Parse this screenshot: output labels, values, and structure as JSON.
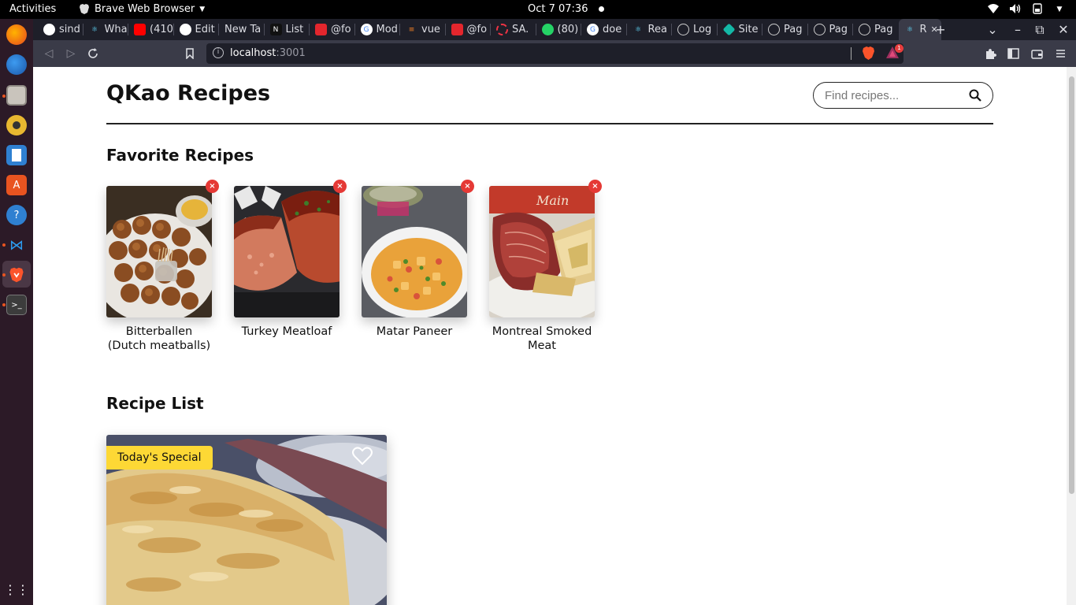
{
  "system": {
    "activities": "Activities",
    "app_name": "Brave Web Browser",
    "clock": "Oct 7  07:36"
  },
  "browser": {
    "tabs": [
      {
        "label": "sind",
        "icon": "github-icon"
      },
      {
        "label": "Wha",
        "icon": "react-icon"
      },
      {
        "label": "(410",
        "icon": "youtube-icon"
      },
      {
        "label": "Edit",
        "icon": "github-icon"
      },
      {
        "label": "New Ta",
        "icon": "none"
      },
      {
        "label": "List",
        "icon": "notion-icon"
      },
      {
        "label": "@fo",
        "icon": "frappe-icon"
      },
      {
        "label": "Mod",
        "icon": "google-icon"
      },
      {
        "label": "vue",
        "icon": "stackoverflow-icon"
      },
      {
        "label": "@fo",
        "icon": "frappe-icon"
      },
      {
        "label": "SA.",
        "icon": "loading-icon"
      },
      {
        "label": "(80)",
        "icon": "whatsapp-icon"
      },
      {
        "label": "doe",
        "icon": "google-icon"
      },
      {
        "label": "Rea",
        "icon": "react-icon"
      },
      {
        "label": "Log",
        "icon": "globe-icon"
      },
      {
        "label": "Site",
        "icon": "diamond-icon"
      },
      {
        "label": "Pag",
        "icon": "globe-icon"
      },
      {
        "label": "Pag",
        "icon": "globe-icon"
      },
      {
        "label": "Pag",
        "icon": "globe-icon"
      },
      {
        "label": "R",
        "icon": "react-icon",
        "active": true
      }
    ],
    "url_host": "localhost",
    "url_port": ":3001",
    "rewards_badge": "1"
  },
  "page": {
    "title": "QKao Recipes",
    "search_placeholder": "Find recipes...",
    "favorites_heading": "Favorite Recipes",
    "favorites": [
      {
        "name": "Bitterballen (Dutch meatballs)"
      },
      {
        "name": "Turkey Meatloaf"
      },
      {
        "name": "Matar Paneer"
      },
      {
        "name": "Montreal Smoked Meat"
      }
    ],
    "remove_symbol": "×",
    "list_heading": "Recipe List",
    "special_badge": "Today's Special"
  },
  "colors": {
    "accent_remove": "#e53935",
    "special_badge": "#fdd835",
    "dock": "#2c1a27",
    "browser_chrome": "#1e1f29"
  }
}
